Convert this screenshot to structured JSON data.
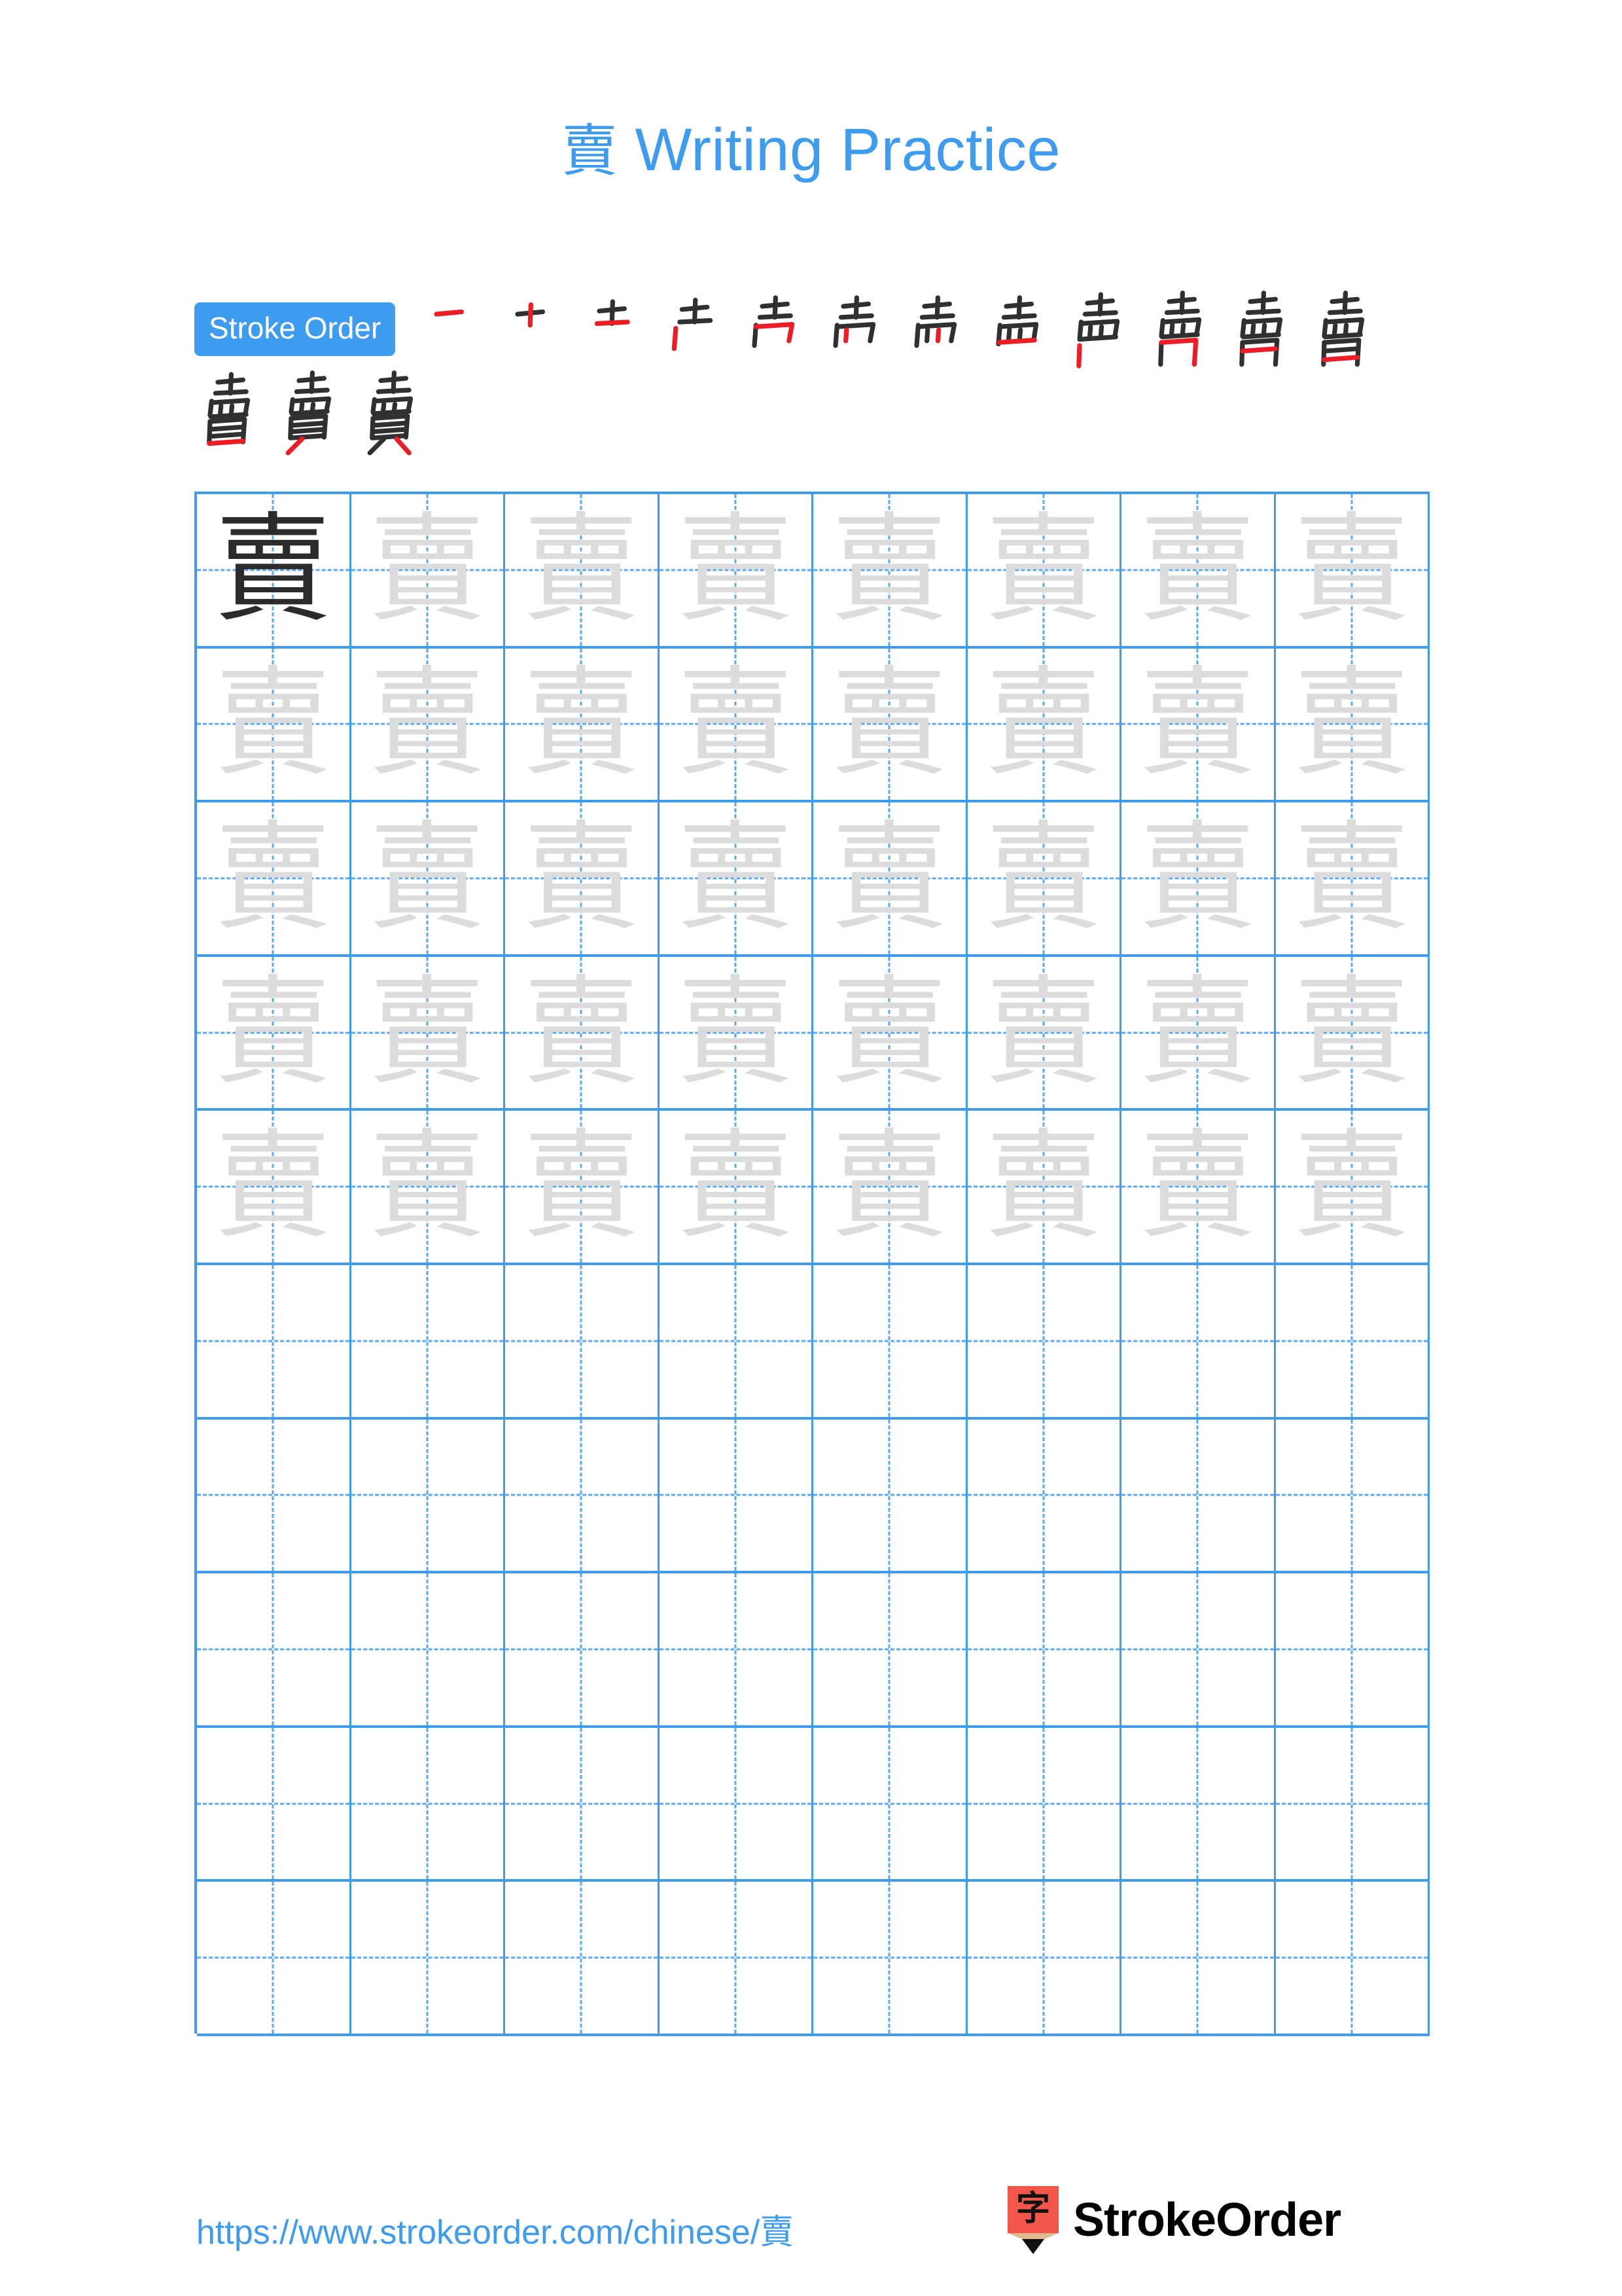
{
  "page": {
    "character": "賣",
    "title_text": "Writing Practice",
    "background_color": "#ffffff",
    "accent_color": "#3d9bf0",
    "trace_color": "#dcdcdc",
    "ink_color": "#2b2b2b",
    "highlight_color": "#ee1c25"
  },
  "stroke_order": {
    "badge_label": "Stroke Order",
    "total_strokes": 15,
    "row1_count": 12,
    "row2_count": 3,
    "steps": [
      {
        "index": 1,
        "char": "賣"
      },
      {
        "index": 2,
        "char": "賣"
      },
      {
        "index": 3,
        "char": "賣"
      },
      {
        "index": 4,
        "char": "賣"
      },
      {
        "index": 5,
        "char": "賣"
      },
      {
        "index": 6,
        "char": "賣"
      },
      {
        "index": 7,
        "char": "賣"
      },
      {
        "index": 8,
        "char": "賣"
      },
      {
        "index": 9,
        "char": "賣"
      },
      {
        "index": 10,
        "char": "賣"
      },
      {
        "index": 11,
        "char": "賣"
      },
      {
        "index": 12,
        "char": "賣"
      },
      {
        "index": 13,
        "char": "賣"
      },
      {
        "index": 14,
        "char": "賣"
      },
      {
        "index": 15,
        "char": "賣"
      }
    ]
  },
  "practice_grid": {
    "columns": 8,
    "rows": 10,
    "filled_rows": 5,
    "empty_rows": 5,
    "first_cell_is_dark": true,
    "cell_character": "賣"
  },
  "footer": {
    "url": "https://www.strokeorder.com/chinese/賣",
    "brand_name": "StrokeOrder",
    "logo_character": "字",
    "logo_body_color": "#f2564b",
    "logo_wood_color": "#e0b98d",
    "logo_tip_color": "#111111"
  }
}
